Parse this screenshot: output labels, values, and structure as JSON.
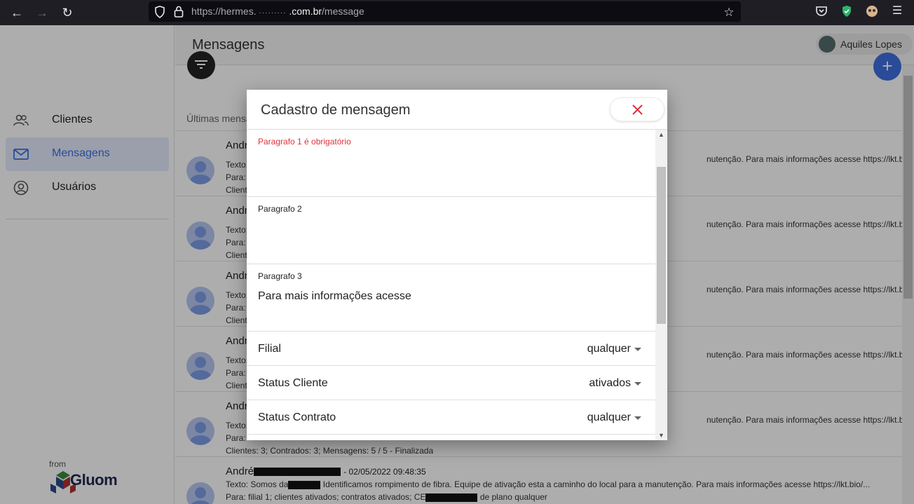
{
  "browser": {
    "url_scheme": "https://hermes.",
    "url_masked": "·········",
    "url_host": ".com.br",
    "url_path": "/message"
  },
  "sidebar": {
    "items": [
      {
        "label": "Clientes",
        "icon": "people-icon"
      },
      {
        "label": "Mensagens",
        "icon": "mail-icon",
        "active": true
      },
      {
        "label": "Usuários",
        "icon": "account-circle-icon"
      }
    ],
    "from_label": "from",
    "brand": "Gluom"
  },
  "header": {
    "title": "Mensagens",
    "user_name": "Aquiles Lopes"
  },
  "list": {
    "recent_label": "Últimas mensagens",
    "messages": [
      {
        "name": "André",
        "line1": "Texto:",
        "line2": "Para:",
        "line3": "Client",
        "right": "nutenção. Para mais informações acesse https://lkt.bio/..."
      },
      {
        "name": "André",
        "line1": "Texto:",
        "line2": "Para:",
        "line3": "Client",
        "right": "nutenção. Para mais informações acesse https://lkt.bio/..."
      },
      {
        "name": "André",
        "line1": "Texto:",
        "line2": "Para:",
        "line3": "Client",
        "right": "nutenção. Para mais informações acesse https://lkt.bio/..."
      },
      {
        "name": "André",
        "line1": "Texto:",
        "line2": "Para:",
        "line3": "Client",
        "right": "nutenção. Para mais informações acesse https://lkt.bio/..."
      },
      {
        "name": "André",
        "line1": "Texto:",
        "line2": "Para:",
        "line3": "Clientes: 3; Contrados: 3; Mensagens: 5 / 5  - Finalizada",
        "right": "nutenção. Para mais informações acesse https://lkt.bio/..."
      },
      {
        "name": "André",
        "date": "- 02/05/2022 09:48:35",
        "line1_pre": "Texto: Somos da",
        "line1_post": "Identificamos rompimento de fibra. Equipe de ativação esta a caminho do local para a manutenção. Para mais informações acesse https://lkt.bio/...",
        "line2_pre": "Para: filial 1; clientes ativados; contratos ativados; CE",
        "line2_post": "de plano qualquer"
      }
    ]
  },
  "modal": {
    "title": "Cadastro de mensagem",
    "fields": [
      {
        "label": "Paragrafo 1 é obrigatório",
        "value": "",
        "error": true
      },
      {
        "label": "Paragrafo 2",
        "value": ""
      },
      {
        "label": "Paragrafo 3",
        "value": "Para mais informações acesse"
      }
    ],
    "selects": [
      {
        "label": "Filial",
        "value": "qualquer"
      },
      {
        "label": "Status Cliente",
        "value": "ativados"
      },
      {
        "label": "Status Contrato",
        "value": "qualquer"
      }
    ]
  },
  "colors": {
    "accent": "#3f6fe0",
    "error": "#e0303a",
    "close_icon": "#e0303a"
  }
}
